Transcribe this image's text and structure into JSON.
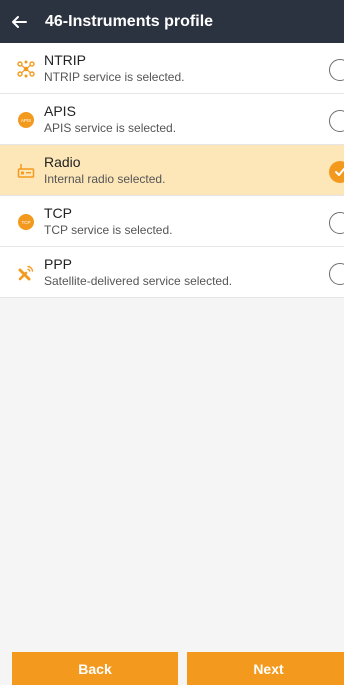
{
  "header": {
    "title": "46-Instruments profile"
  },
  "items": [
    {
      "name": "NTRIP",
      "desc": "NTRIP service is selected.",
      "selected": false,
      "icon": "ntrip-icon"
    },
    {
      "name": "APIS",
      "desc": "APIS service is selected.",
      "selected": false,
      "icon": "apis-icon",
      "icon_text": "APIS"
    },
    {
      "name": "Radio",
      "desc": "Internal radio selected.",
      "selected": true,
      "icon": "radio-icon"
    },
    {
      "name": "TCP",
      "desc": "TCP service is selected.",
      "selected": false,
      "icon": "tcp-icon",
      "icon_text": "TCP"
    },
    {
      "name": "PPP",
      "desc": "Satellite-delivered service selected.",
      "selected": false,
      "icon": "satellite-icon"
    }
  ],
  "footer": {
    "back_label": "Back",
    "next_label": "Next"
  },
  "colors": {
    "header_bg": "#2c3340",
    "accent": "#f39a1e",
    "selected_bg": "#fde7b8"
  }
}
